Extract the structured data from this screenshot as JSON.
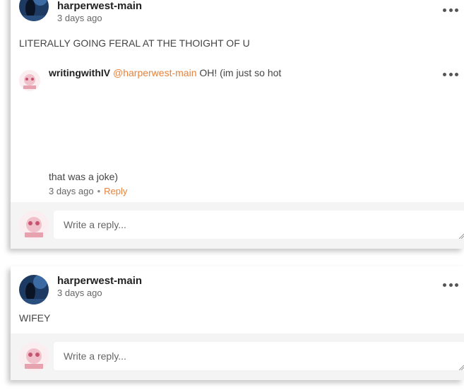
{
  "threads": [
    {
      "author": "harperwest-main",
      "time": "3 days ago",
      "text": "LITERALLY GOING FERAL AT THE THOIGHT OF U",
      "replies": [
        {
          "author": "writingwithIV",
          "mention": "@harperwest-main",
          "text_line1": "OH! (im just so hot",
          "text_line2": "that was a joke)",
          "time": "3 days ago",
          "separator": "•",
          "reply_label": "Reply"
        }
      ],
      "reply_placeholder": "Write a reply..."
    },
    {
      "author": "harperwest-main",
      "time": "3 days ago",
      "text": "WIFEY",
      "reply_placeholder": "Write a reply..."
    }
  ],
  "colors": {
    "mention": "#e8823a",
    "reply_bar": "#f4f4f4",
    "avatar_dark": "#1d3a63"
  },
  "icons": [
    "more-options-icon",
    "author-avatar",
    "user-avatar"
  ]
}
